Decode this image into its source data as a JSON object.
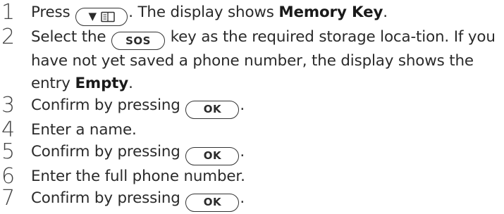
{
  "steps": [
    {
      "num": "1",
      "a": "Press ",
      "b": ". The display shows ",
      "bold": "Memory Key",
      "c": "."
    },
    {
      "num": "2",
      "a": "Select the ",
      "b": " key as the required storage loca-tion. If you have not yet saved a phone number, the display shows the entry ",
      "bold": "Empty",
      "c": "."
    },
    {
      "num": "3",
      "a": "Confirm by pressing ",
      "b": "."
    },
    {
      "num": "4",
      "a": "Enter a name."
    },
    {
      "num": "5",
      "a": "Confirm by pressing ",
      "b": "."
    },
    {
      "num": "6",
      "a": "Enter the full phone number."
    },
    {
      "num": "7",
      "a": "Confirm by pressing ",
      "b": "."
    }
  ],
  "keys": {
    "menu_arrow": "▼",
    "menu_icon": "phonebook-icon",
    "sos": "SOS",
    "ok": "OK"
  }
}
